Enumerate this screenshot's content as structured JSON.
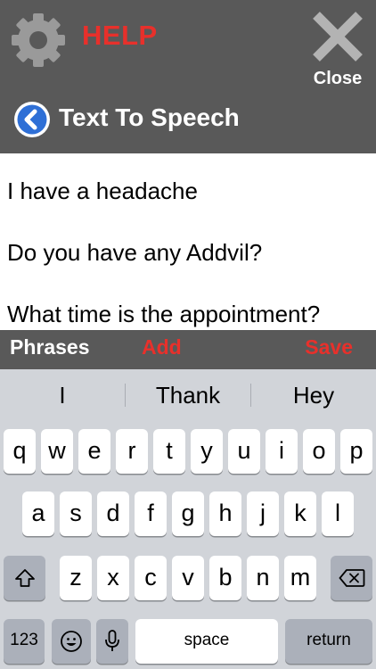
{
  "header": {
    "settings_icon": "gear-icon",
    "help_label": "HELP",
    "close_label": "Close",
    "close_icon": "close-x-icon",
    "back_icon": "back-arrow-icon",
    "title": "Text To Speech"
  },
  "text_area": {
    "lines": [
      "I have a headache",
      "Do you have any Addvil?",
      "What time is the appointment?"
    ]
  },
  "toolbar": {
    "phrases_label": "Phrases",
    "add_label": "Add",
    "save_label": "Save"
  },
  "keyboard": {
    "suggestions": [
      "I",
      "Thank",
      "Hey"
    ],
    "row1": [
      "q",
      "w",
      "e",
      "r",
      "t",
      "y",
      "u",
      "i",
      "o",
      "p"
    ],
    "row2": [
      "a",
      "s",
      "d",
      "f",
      "g",
      "h",
      "j",
      "k",
      "l"
    ],
    "row3": [
      "z",
      "x",
      "c",
      "v",
      "b",
      "n",
      "m"
    ],
    "numbers_label": "123",
    "space_label": "space",
    "return_label": "return"
  },
  "colors": {
    "header_bg": "#595959",
    "accent_red": "#e8302b",
    "gear_gray": "#9a9a9a",
    "back_blue": "#2e6fd6"
  }
}
